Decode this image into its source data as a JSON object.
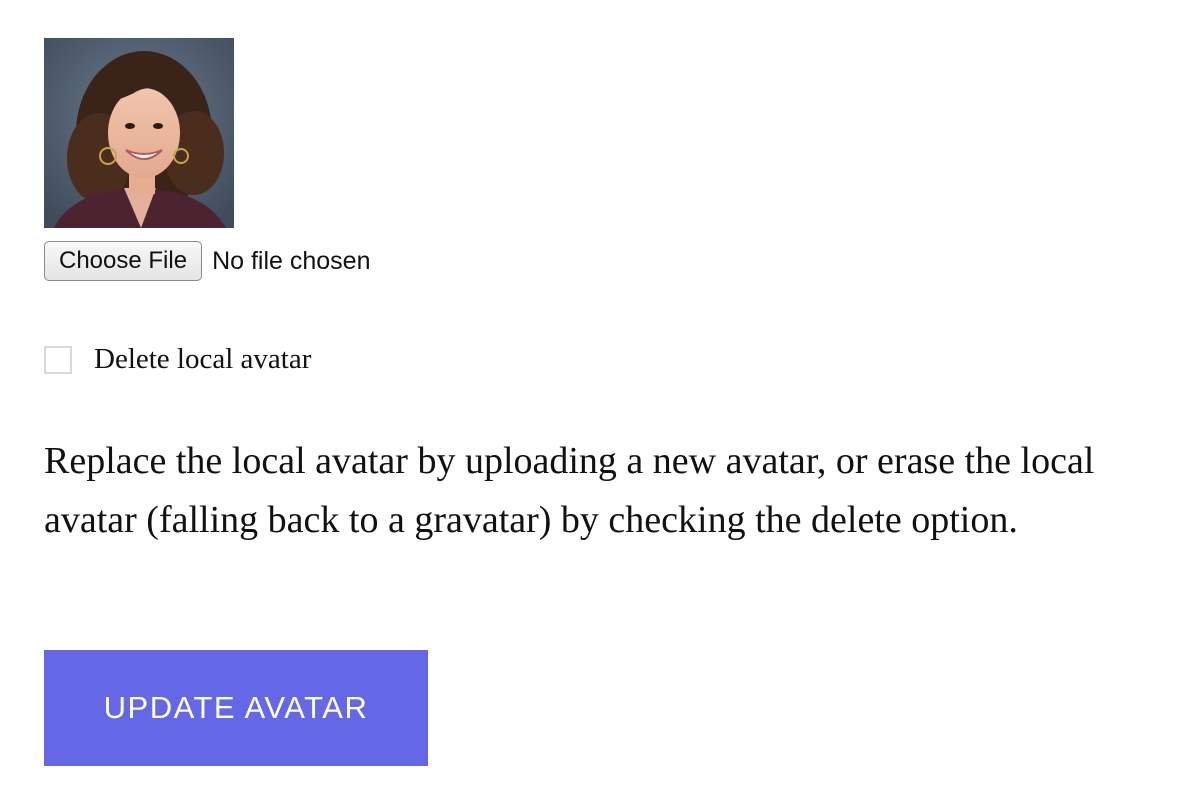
{
  "avatar": {
    "background_color": "#4a5a6b"
  },
  "file_input": {
    "button_label": "Choose File",
    "status_text": "No file chosen"
  },
  "delete_option": {
    "label": "Delete local avatar",
    "checked": false
  },
  "description": "Replace the local avatar by uploading a new avatar, or erase the local avatar (falling back to a gravatar) by checking the delete option.",
  "submit": {
    "label": "UPDATE AVATAR",
    "color": "#6468e6"
  }
}
